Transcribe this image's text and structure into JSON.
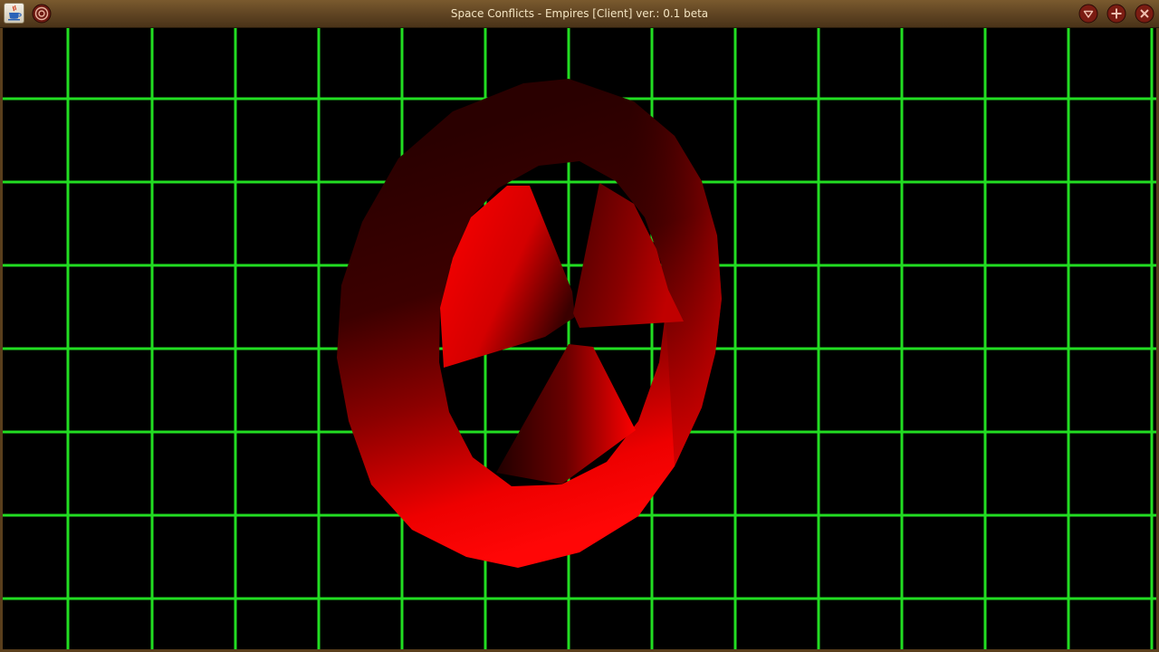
{
  "window": {
    "title": "Space Conflicts - Empires [Client] ver.: 0.1 beta",
    "app_icon": "java-coffee-cup-icon",
    "menu_icon": "window-menu-icon",
    "buttons": {
      "minimize": "minimize-icon",
      "maximize": "maximize-icon",
      "close": "close-icon"
    }
  },
  "scene": {
    "background_color": "#000000",
    "grid_color": "#22dd22",
    "object": "red-torus-with-three-cone-blades",
    "object_color": "#ff0000"
  }
}
